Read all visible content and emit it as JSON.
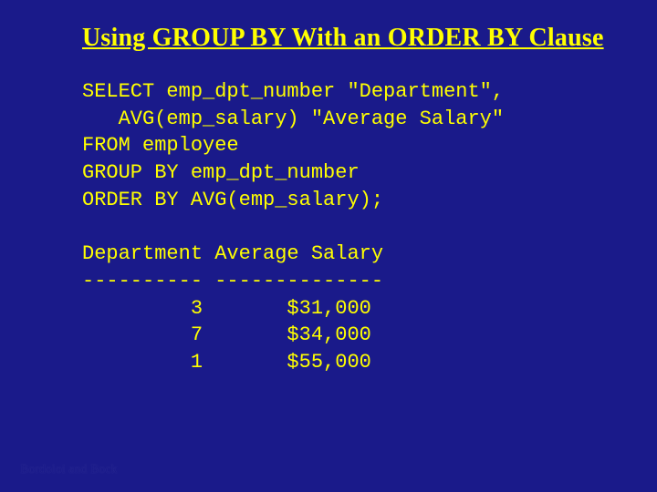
{
  "title": "Using GROUP BY With an ORDER BY Clause",
  "sql": {
    "line1": "SELECT emp_dpt_number \"Department\",",
    "line2": "   AVG(emp_salary) \"Average Salary\"",
    "line3": "FROM employee",
    "line4": "GROUP BY emp_dpt_number",
    "line5": "ORDER BY AVG(emp_salary);"
  },
  "result": {
    "header": "Department Average Salary",
    "divider": "---------- --------------",
    "rows": [
      "         3       $31,000",
      "         7       $34,000",
      "         1       $55,000"
    ]
  },
  "footer": "Bordoloi and Bock"
}
